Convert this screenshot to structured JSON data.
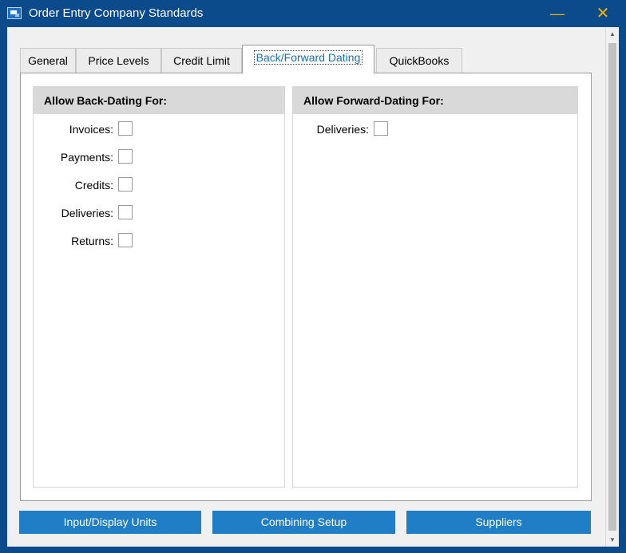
{
  "window": {
    "title": "Order Entry Company Standards",
    "minimize_glyph": "—",
    "close_glyph": "✕",
    "accent_color": "#0b4a8b",
    "caption_button_color": "#f0b400"
  },
  "tabs": [
    {
      "label": "General",
      "active": false
    },
    {
      "label": "Price Levels",
      "active": false
    },
    {
      "label": "Credit Limit",
      "active": false
    },
    {
      "label": "Back/Forward Dating",
      "active": true
    },
    {
      "label": "QuickBooks",
      "active": false
    }
  ],
  "back_dating": {
    "header": "Allow Back-Dating For:",
    "items": [
      {
        "label": "Invoices:",
        "checked": false
      },
      {
        "label": "Payments:",
        "checked": false
      },
      {
        "label": "Credits:",
        "checked": false
      },
      {
        "label": "Deliveries:",
        "checked": false
      },
      {
        "label": "Returns:",
        "checked": false
      }
    ]
  },
  "forward_dating": {
    "header": "Allow Forward-Dating For:",
    "items": [
      {
        "label": "Deliveries:",
        "checked": false
      }
    ]
  },
  "buttons": {
    "input_display_units": "Input/Display Units",
    "combining_setup": "Combining Setup",
    "suppliers": "Suppliers",
    "button_color": "#1f7ec6"
  },
  "scrollbar": {
    "up_glyph": "▲",
    "down_glyph": "▼"
  }
}
